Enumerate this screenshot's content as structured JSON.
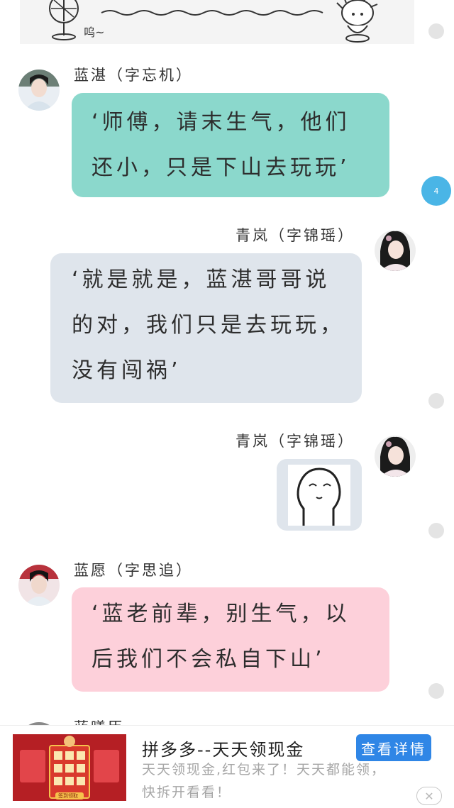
{
  "top_strip": {
    "sound_text": "呜~"
  },
  "messages": [
    {
      "name": "蓝湛（字忘机）",
      "text_line1": "‘师傅，请末生气，他们",
      "text_line2": "还小，只是下山去玩玩’"
    },
    {
      "name": "青岚（字锦瑶）",
      "text_line1": "‘就是就是，蓝湛哥哥说",
      "text_line2": "的对，我们只是去玩玩，",
      "text_line3": "没有闯祸’"
    },
    {
      "name": "青岚（字锦瑶）",
      "sticker": "face-sticker"
    },
    {
      "name": "蓝愿（字思追）",
      "text_line1": "‘蓝老前辈，别生气，以",
      "text_line2": "后我们不会私自下山’"
    },
    {
      "name": "蓝曦臣"
    }
  ],
  "badge_count": "4",
  "ad": {
    "title": "拼多多--天天领现金",
    "desc_line1": "天天领现金,红包来了！天天都能领，",
    "desc_line2": "快拆开看看！",
    "button": "查看详情",
    "close": "✕",
    "image_caption": "签到领取"
  },
  "colors": {
    "teal": "#8bd8cc",
    "grey": "#dfe5ec",
    "pink": "#fdd0da",
    "badge": "#4ab5e6",
    "ad_button": "#2f86e6"
  }
}
